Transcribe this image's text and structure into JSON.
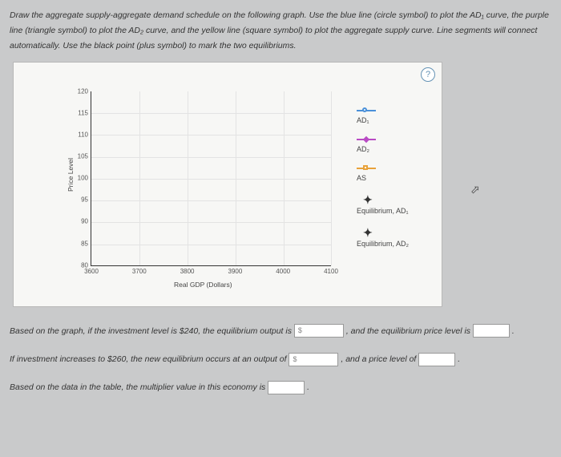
{
  "instructions": "Draw the aggregate supply-aggregate demand schedule on the following graph. Use the blue line (circle symbol) to plot the AD₁ curve, the purple line (triangle symbol) to plot the AD₂ curve, and the yellow line (square symbol) to plot the aggregate supply curve. Line segments will connect automatically. Use the black point (plus symbol) to mark the two equilibriums.",
  "chart_data": {
    "type": "scatter",
    "title": "",
    "xlabel": "Real GDP (Dollars)",
    "ylabel": "Price Level",
    "xlim": [
      3600,
      4100
    ],
    "ylim": [
      80,
      120
    ],
    "x_ticks": [
      3600,
      3700,
      3800,
      3900,
      4000,
      4100
    ],
    "y_ticks": [
      80,
      85,
      90,
      95,
      100,
      105,
      110,
      115,
      120
    ],
    "series": [
      {
        "name": "AD₁",
        "marker": "circle",
        "color": "#4a90d9",
        "values": []
      },
      {
        "name": "AD₂",
        "marker": "diamond",
        "color": "#b94bc4",
        "values": []
      },
      {
        "name": "AS",
        "marker": "square",
        "color": "#e8a23a",
        "values": []
      },
      {
        "name": "Equilibrium, AD₁",
        "marker": "plus",
        "color": "#333",
        "values": []
      },
      {
        "name": "Equilibrium, AD₂",
        "marker": "plus",
        "color": "#333",
        "values": []
      }
    ]
  },
  "legend": {
    "ad1": "AD₁",
    "ad2": "AD₂",
    "as": "AS",
    "eq1": "Equilibrium, AD₁",
    "eq2": "Equilibrium, AD₂"
  },
  "q": {
    "line1a": "Based on the graph, if the investment level is $240, the equilibrium output is ",
    "line1b": ", and the equilibrium price level is ",
    "line2a": "If investment increases to $260, the new equilibrium occurs at an output of ",
    "line2b": ", and a price level of ",
    "line3": "Based on the data in the table, the multiplier value in this economy is ",
    "period": ".",
    "dollar": "$"
  },
  "help": "?"
}
